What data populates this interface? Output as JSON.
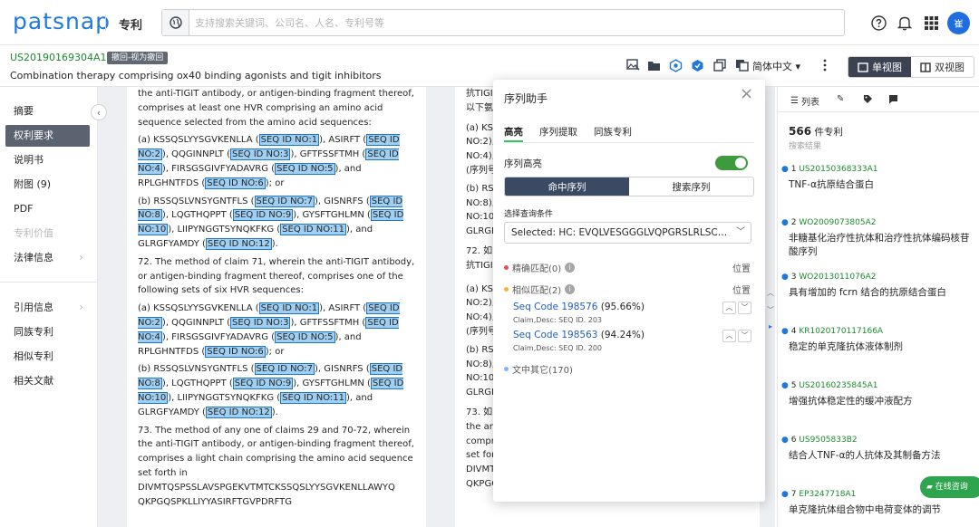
{
  "brand": "patsnap",
  "section": "专利",
  "search": {
    "placeholder": "支持搜索关键词、公司名、人名、专利号等"
  },
  "user": {
    "avatar_text": "崔"
  },
  "patent": {
    "number": "US20190169304A1",
    "status": "撤回-视为撤回",
    "title": "Combination therapy comprising ox40 binding agonists and tigit inhibitors"
  },
  "toolbar": {
    "language": "简体中文 ▾",
    "single_view": "单视图",
    "dual_view": "双视图"
  },
  "nav": {
    "items": [
      {
        "label": "摘要"
      },
      {
        "label": "权利要求"
      },
      {
        "label": "说明书"
      },
      {
        "label": "附图 (9)"
      },
      {
        "label": "PDF"
      },
      {
        "label": "专利价值"
      },
      {
        "label": "法律信息"
      },
      {
        "label": "引用信息"
      },
      {
        "label": "同族专利"
      },
      {
        "label": "相似专利"
      },
      {
        "label": "相关文献"
      }
    ]
  },
  "doc_left": {
    "p1": [
      "the anti-TIGIT antibody, or antigen-binding fragment thereof, comprises at least one HVR comprising an amino acid sequence selected from the amino acid sequences:"
    ],
    "a1": [
      "(a) KSSQSLYYSGVKENLLA (",
      "SEQ ID NO:1",
      "), ASIRFT (",
      "SEQ ID NO:2",
      "), QQGINNPLT (",
      "SEQ ID NO:3",
      "), GFTFSSFTMH (",
      "SEQ ID NO:4",
      "), FIRSGSGIVFYADAVRG (",
      "SEQ ID NO:5",
      "), and RPLGHNTFDS (",
      "SEQ ID NO:6",
      "); or"
    ],
    "b1": [
      "(b) RSSQSLVNSYGNTFLS (",
      "SEQ ID NO:7",
      "), GISNRFS (",
      "SEQ ID NO:8",
      "), LQGTHQPPT (",
      "SEQ ID NO:9",
      "), GYSFTGHLMN (",
      "SEQ ID NO:10",
      "), LIIPYNGGTSYNQKFKG (",
      "SEQ ID NO:11",
      "), and GLRGFYAMDY (",
      "SEQ ID NO:12",
      ")."
    ],
    "p2": [
      "72. The method of claim 71, wherein the anti-TIGIT antibody, or antigen-binding fragment thereof, comprises one of the following sets of six HVR sequences:"
    ],
    "a2": [
      "(a) KSSQSLYYSGVKENLLA (",
      "SEQ ID NO:1",
      "), ASIRFT (",
      "SEQ ID NO:2",
      "), QQGINNPLT (",
      "SEQ ID NO:3",
      "), GFTFSSFTMH (",
      "SEQ ID NO:4",
      "), FIRSGSGIVFYADAVRG (",
      "SEQ ID NO:5",
      "), and RPLGHNTFDS (",
      "SEQ ID NO:6",
      "); or"
    ],
    "b2": [
      "(b) RSSQSLVNSYGNTFLS (",
      "SEQ ID NO:7",
      "), GISNRFS (",
      "SEQ ID NO:8",
      "), LQGTHQPPT (",
      "SEQ ID NO:9",
      "), GYSFTGHLMN (",
      "SEQ ID NO:10",
      "), LIIPYNGGTSYNQKFKG (",
      "SEQ ID NO:11",
      "), and GLRGFYAMDY (",
      "SEQ ID NO:12",
      ")."
    ],
    "p3": [
      "73. The method of any one of claims 29 and 70-72, wherein the anti-TIGIT antibody, or antigen-binding fragment thereof, comprises a light chain comprising the amino acid sequence set forth in DIVMTQSPSSLAVSPGEKVTMTCKSSQSLYYSGVKENLLAWYQ QKPGQSPKLLIYYASIRFTGVPDRFTG"
    ]
  },
  "doc_right": {
    "r1": [
      "抗TIGI",
      "以下氨"
    ],
    "r2": [
      "(a) KS",
      "NO:2),",
      "NO:4),",
      "(序列号"
    ],
    "r3": [
      "(b) RS",
      "NO:8),",
      "NO:10)",
      "GLRGI"
    ],
    "r4": [
      "72. 如",
      "抗TIGI"
    ],
    "r5": [
      "(a) KS",
      "NO:2),",
      "NO:4),",
      "(序列号"
    ],
    "r6": [
      "(b) RS",
      "NO:8),",
      "NO:10)",
      "GLRGI"
    ],
    "r7": [
      "73. 如",
      "the an",
      "compr",
      "set for",
      "DIVMTQSPSSLAVSPGEKVTMTCKSSQSLYYSGVKENLLAWYQ",
      "QKPGQSPKLLIYYASIRFTGVPDRFTG"
    ]
  },
  "seq_dialog": {
    "title": "序列助手",
    "close": "×",
    "tabs": [
      "高亮",
      "序列提取",
      "同族专利"
    ],
    "toggle_label": "序列高亮",
    "toggle_on": true,
    "seg_active": "命中序列",
    "seg_other": "搜索序列",
    "cond_label": "选择查询条件",
    "select_value": "Selected: HC: EVQLVESGGGLVQPGRSLRLSCAASGFTFDDYAMH",
    "exact_label": "精确匹配(0)",
    "similar_label": "相似匹配(2)",
    "position_label": "位置",
    "matches": [
      {
        "code": "Seq Code 198576",
        "pct": "(95.66%)",
        "sub": "Claim,Desc: SEQ ID. 203"
      },
      {
        "code": "Seq Code 198563",
        "pct": "(94.24%)",
        "sub": "Claim,Desc: SEQ ID. 200"
      }
    ],
    "other_label": "文中其它(170)",
    "colors": {
      "exact": "#e05252",
      "similar": "#f2b632",
      "other": "#7ab8f5"
    }
  },
  "right_panel": {
    "tab_list": "列表",
    "count": "566",
    "count_unit": " 件专利",
    "subtitle": "搜索结果",
    "results": [
      {
        "n": "1",
        "pn": "US20150368333A1",
        "title": "TNF-α抗原结合蛋白"
      },
      {
        "n": "2",
        "pn": "WO2009073805A2",
        "title": "非糖基化治疗性抗体和治疗性抗体编码核苷酸序列"
      },
      {
        "n": "3",
        "pn": "WO2013011076A2",
        "title": "具有增加的 fcrn 结合的抗原结合蛋白"
      },
      {
        "n": "4",
        "pn": "KR1020170117166A",
        "title": "稳定的单克隆抗体液体制剂"
      },
      {
        "n": "5",
        "pn": "US20160235845A1",
        "title": "增强抗体稳定性的缓冲液配方"
      },
      {
        "n": "6",
        "pn": "US9505833B2",
        "title": "结合人TNF-α的人抗体及其制备方法"
      },
      {
        "n": "7",
        "pn": "EP3247718A1",
        "title": "单克隆抗体组合物中电荷变体的调节"
      }
    ]
  },
  "consult": "在线咨询"
}
